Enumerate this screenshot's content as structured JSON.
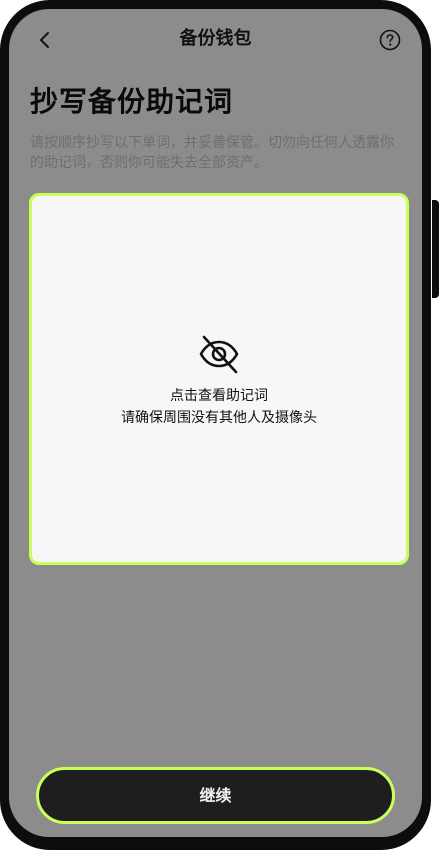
{
  "header": {
    "title": "备份钱包",
    "back_icon": "chevron-left-icon",
    "help_icon": "question-circle-icon"
  },
  "main": {
    "title": "抄写备份助记词",
    "description": "请按顺序抄写以下单词，并妥善保管。切勿向任何人透露你的助记词，否则你可能失去全部资产。"
  },
  "reveal_card": {
    "icon": "eye-slash-icon",
    "line1": "点击查看助记词",
    "line2": "请确保周围没有其他人及摄像头"
  },
  "footer": {
    "continue_label": "继续"
  },
  "colors": {
    "accent": "#c8ff5a",
    "overlay": "#8c8c8c",
    "button_bg": "#1e1e1e",
    "card_bg": "#f7f7f7"
  }
}
